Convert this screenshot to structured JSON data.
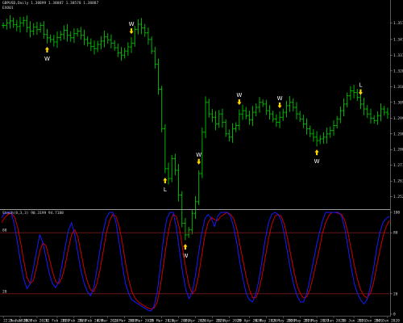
{
  "window": {
    "symbol_info": "GBPUSD,Daily 1.38899 1.38887 1.38578 1.38887",
    "expert_label": "EXO01",
    "indicator_info": "Stoch(8,3,3) 90.3199 94.7188"
  },
  "colors": {
    "background": "#000000",
    "candle": "#00c800",
    "arrow": "#ffd700",
    "stoch_main": "#1a1aff",
    "stoch_signal": "#cc0000",
    "level_line": "#7a1a1a",
    "grid_text": "#d8d8d8",
    "panel_border": "#9a9a9a"
  },
  "price_axis": {
    "ticks": [
      "1.3570",
      "1.3470",
      "1.3375",
      "1.3280",
      "1.3185",
      "1.3090",
      "1.2995",
      "1.2900",
      "1.2805",
      "1.2710",
      "1.2615",
      "1.2520"
    ]
  },
  "stoch_axis": {
    "ticks": [
      "100",
      "80",
      "20",
      "0"
    ]
  },
  "levels": {
    "upper_label": "80",
    "lower_label": "20"
  },
  "time_axis": {
    "ticks": [
      "22 Jan 2020",
      "29 Jan 2020",
      "5 Feb 2020",
      "12 Feb 2020",
      "19 Feb 2020",
      "26 Feb 2020",
      "4 Mar 2020",
      "11 Mar 2020",
      "18 Mar 2020",
      "25 Mar 2020",
      "1 Apr 2020",
      "8 Apr 2020",
      "15 Apr 2020",
      "22 Apr 2020",
      "29 Apr 2020",
      "6 May 2020",
      "13 May 2020",
      "20 May 2020",
      "27 May 2020",
      "3 Jun 2020",
      "10 Jun 2020",
      "17 Jun 2020",
      "24 Jun 2020"
    ]
  },
  "chart_data": [
    {
      "type": "candlestick",
      "title": "GBPUSD,Daily",
      "ylim": [
        1.246,
        1.364
      ],
      "closes": [
        1.3555,
        1.357,
        1.3582,
        1.356,
        1.3548,
        1.357,
        1.3585,
        1.3542,
        1.352,
        1.3545,
        1.353,
        1.3555,
        1.35,
        1.348,
        1.347,
        1.3455,
        1.3482,
        1.35,
        1.3525,
        1.3495,
        1.348,
        1.3505,
        1.352,
        1.3495,
        1.347,
        1.3448,
        1.3428,
        1.3415,
        1.344,
        1.346,
        1.3485,
        1.3468,
        1.3448,
        1.342,
        1.339,
        1.3375,
        1.34,
        1.3425,
        1.3448,
        1.353,
        1.3562,
        1.354,
        1.351,
        1.347,
        1.34,
        1.332,
        1.317,
        1.293,
        1.269,
        1.263,
        1.275,
        1.268,
        1.253,
        1.236,
        1.229,
        1.232,
        1.242,
        1.249,
        1.266,
        1.291,
        1.309,
        1.302,
        1.3,
        1.296,
        1.302,
        1.297,
        1.29,
        1.288,
        1.293,
        1.295,
        1.302,
        1.304,
        1.301,
        1.2985,
        1.303,
        1.306,
        1.309,
        1.308,
        1.304,
        1.302,
        1.299,
        1.297,
        1.3,
        1.303,
        1.307,
        1.309,
        1.306,
        1.302,
        1.299,
        1.296,
        1.293,
        1.29,
        1.288,
        1.286,
        1.287,
        1.288,
        1.29,
        1.292,
        1.295,
        1.299,
        1.304,
        1.308,
        1.313,
        1.316,
        1.315,
        1.312,
        1.308,
        1.305,
        1.302,
        1.2995,
        1.298,
        1.301,
        1.305,
        1.303,
        1.302
      ],
      "markers": [
        {
          "bar": 13,
          "type": "W",
          "direction": "up"
        },
        {
          "bar": 38,
          "type": "W",
          "direction": "down"
        },
        {
          "bar": 48,
          "type": "L",
          "direction": "up"
        },
        {
          "bar": 54,
          "type": "W",
          "direction": "up"
        },
        {
          "bar": 58,
          "type": "W",
          "direction": "down"
        },
        {
          "bar": 70,
          "type": "W",
          "direction": "down"
        },
        {
          "bar": 82,
          "type": "W",
          "direction": "down"
        },
        {
          "bar": 93,
          "type": "W",
          "direction": "up"
        },
        {
          "bar": 106,
          "type": "L",
          "direction": "down"
        },
        {
          "bar": 115,
          "type": "W",
          "direction": "up"
        }
      ]
    },
    {
      "type": "line",
      "title": "Stoch(8,3,3)",
      "ylim": [
        0,
        100
      ],
      "levels": [
        80,
        20
      ],
      "series": [
        {
          "values": [
            95,
            99,
            100,
            100,
            88,
            70,
            50,
            34,
            25,
            30,
            45,
            62,
            78,
            70,
            55,
            40,
            30,
            26,
            32,
            48,
            66,
            82,
            90,
            78,
            60,
            42,
            30,
            22,
            18,
            26,
            44,
            64,
            82,
            95,
            100,
            100,
            90,
            70,
            48,
            30,
            20,
            14,
            12,
            10,
            8,
            6,
            4,
            3,
            8,
            22,
            48,
            76,
            94,
            100,
            100,
            85,
            62,
            40,
            24,
            15,
            22,
            38,
            60,
            80,
            94,
            98,
            94,
            86,
            96,
            100,
            100,
            100,
            96,
            86,
            70,
            50,
            34,
            20,
            14,
            12,
            20,
            34,
            54,
            74,
            90,
            98,
            100,
            98,
            92,
            78,
            60,
            42,
            28,
            18,
            12,
            12,
            20,
            34,
            50,
            66,
            80,
            92,
            100,
            100,
            100,
            100,
            100,
            96,
            84,
            66,
            46,
            30,
            20,
            14,
            10,
            14,
            26,
            44,
            64,
            80,
            90,
            94,
            96
          ]
        },
        {
          "values": [
            90,
            95,
            98,
            99,
            96,
            86,
            70,
            52,
            36,
            30,
            33,
            46,
            62,
            70,
            67,
            55,
            42,
            32,
            30,
            36,
            48,
            64,
            78,
            83,
            76,
            60,
            44,
            32,
            24,
            22,
            30,
            44,
            62,
            80,
            92,
            98,
            96,
            86,
            70,
            50,
            34,
            22,
            16,
            12,
            10,
            8,
            6,
            5,
            6,
            12,
            28,
            50,
            72,
            90,
            98,
            96,
            84,
            64,
            44,
            28,
            20,
            24,
            38,
            58,
            78,
            90,
            95,
            93,
            92,
            96,
            98,
            100,
            98,
            94,
            84,
            68,
            52,
            36,
            24,
            16,
            16,
            24,
            38,
            56,
            74,
            88,
            96,
            98,
            96,
            88,
            74,
            58,
            42,
            28,
            20,
            16,
            17,
            24,
            36,
            50,
            64,
            80,
            90,
            97,
            100,
            100,
            99,
            98,
            92,
            80,
            64,
            48,
            34,
            24,
            18,
            16,
            20,
            30,
            46,
            62,
            76,
            86,
            92
          ]
        }
      ]
    }
  ]
}
